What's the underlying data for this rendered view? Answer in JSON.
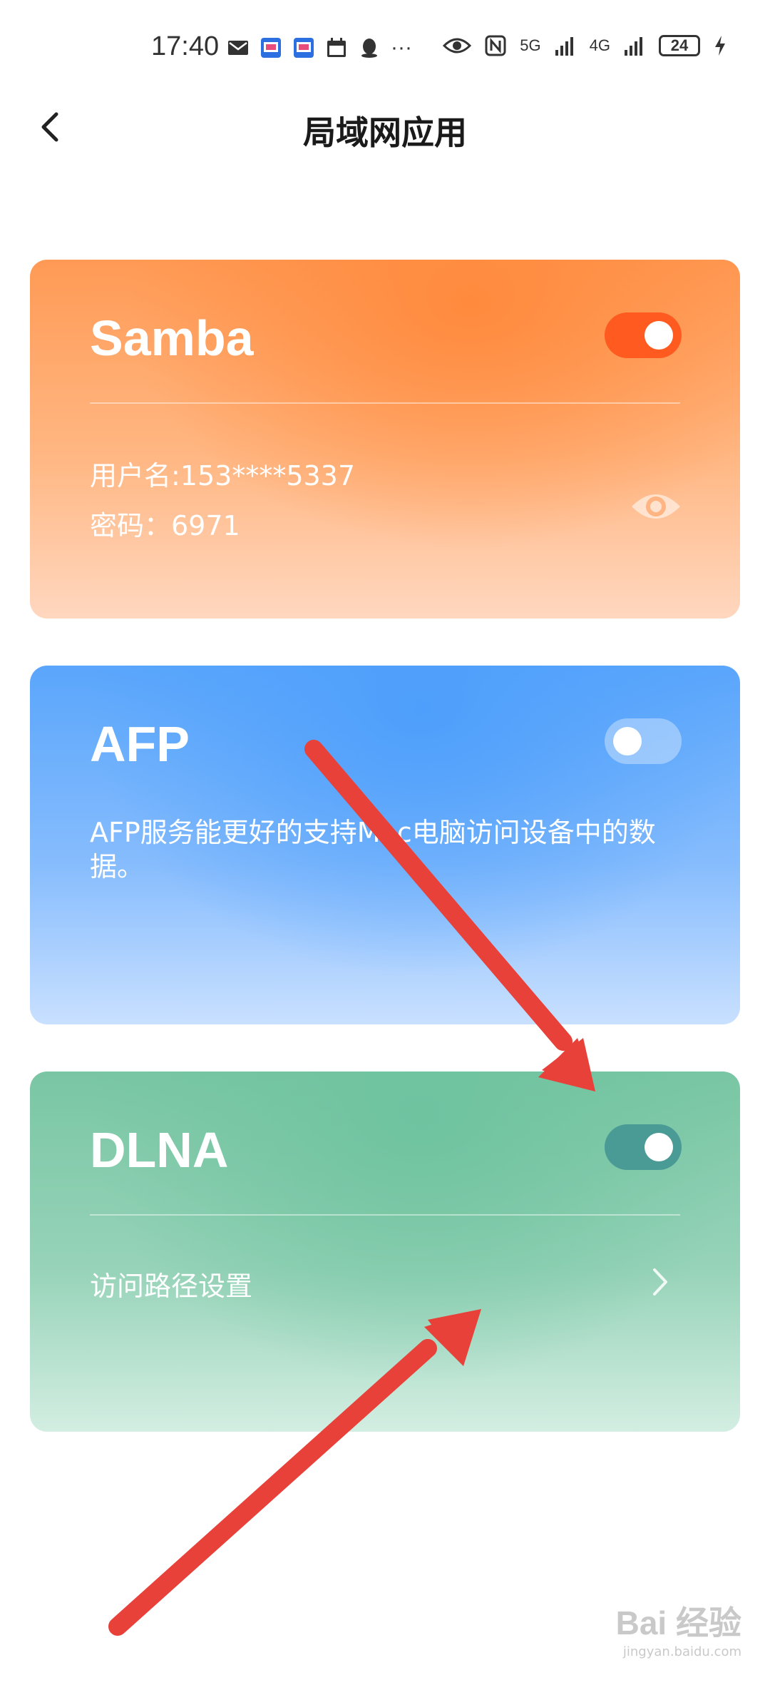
{
  "status_bar": {
    "time": "17:40",
    "more": "···",
    "network1": "5G",
    "network2": "4G",
    "battery": "24",
    "left_icons": [
      "mail-icon",
      "app-icon",
      "app-icon",
      "calendar-icon",
      "qq-icon"
    ],
    "right_icons": [
      "eye-icon",
      "nfc-icon",
      "signal-icon",
      "signal-icon",
      "charging-icon"
    ]
  },
  "header": {
    "title": "局域网应用",
    "back_icon": "back-arrow-icon"
  },
  "cards": {
    "samba": {
      "title": "Samba",
      "enabled": true,
      "username": "用户名:153****5337",
      "password": "密码：6971",
      "toggle_color": "#ff5a1f"
    },
    "afp": {
      "title": "AFP",
      "enabled": false,
      "description": "AFP服务能更好的支持Mac电脑访问设备中的数据。"
    },
    "dlna": {
      "title": "DLNA",
      "enabled": true,
      "path_setting": "访问路径设置",
      "toggle_color": "#4a9a96"
    }
  },
  "colors": {
    "samba": "#ff8a3d",
    "afp": "#4e9ffb",
    "dlna": "#6fc39f",
    "annotation_arrow": "#e8413a"
  },
  "watermark": {
    "main": "Bai 经验",
    "sub": "jingyan.baidu.com"
  }
}
